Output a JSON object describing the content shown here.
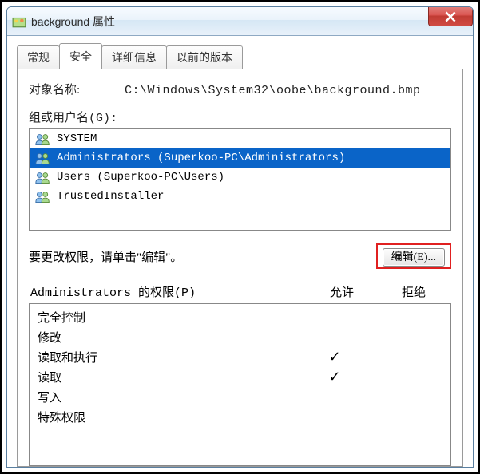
{
  "window": {
    "title": "background 属性"
  },
  "tabs": [
    {
      "label": "常规"
    },
    {
      "label": "安全"
    },
    {
      "label": "详细信息"
    },
    {
      "label": "以前的版本"
    }
  ],
  "security": {
    "object_name_label": "对象名称:",
    "object_name_value": "C:\\Windows\\System32\\oobe\\background.bmp",
    "group_user_label": "组或用户名(G):",
    "groups": [
      {
        "name": "SYSTEM"
      },
      {
        "name": "Administrators (Superkoo-PC\\Administrators)",
        "selected": true
      },
      {
        "name": "Users (Superkoo-PC\\Users)"
      },
      {
        "name": "TrustedInstaller"
      }
    ],
    "edit_hint": "要更改权限，请单击\"编辑\"。",
    "edit_button": "编辑(E)...",
    "permissions_for": "Administrators 的权限(P)",
    "allow_label": "允许",
    "deny_label": "拒绝",
    "permissions": [
      {
        "name": "完全控制",
        "allow": false,
        "deny": false
      },
      {
        "name": "修改",
        "allow": false,
        "deny": false
      },
      {
        "name": "读取和执行",
        "allow": true,
        "deny": false
      },
      {
        "name": "读取",
        "allow": true,
        "deny": false
      },
      {
        "name": "写入",
        "allow": false,
        "deny": false
      },
      {
        "name": "特殊权限",
        "allow": false,
        "deny": false
      }
    ]
  }
}
